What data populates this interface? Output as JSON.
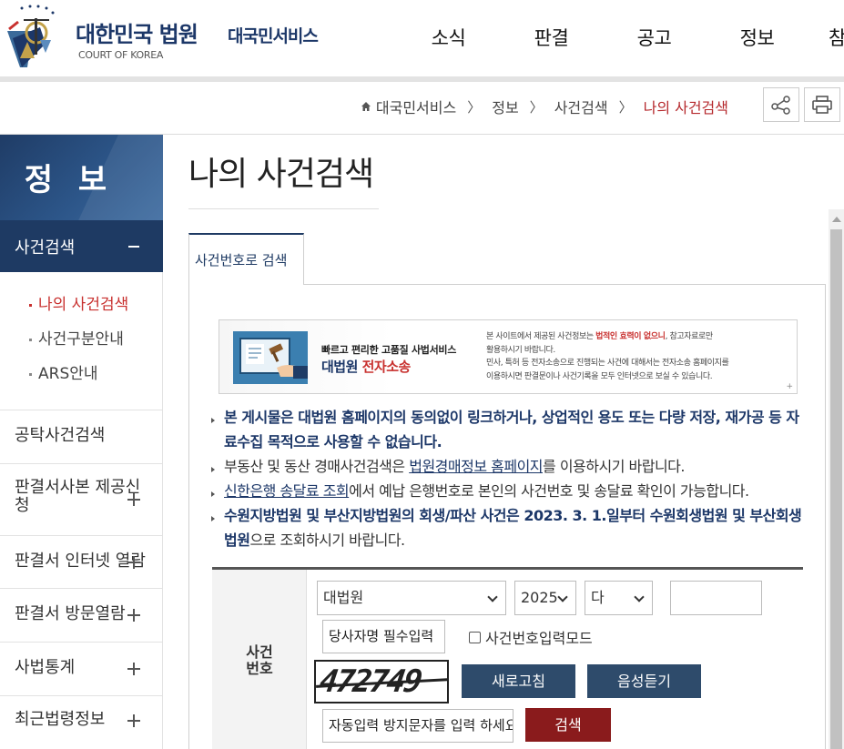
{
  "header": {
    "logo_title": "대한민국 법원",
    "logo_sub": "COURT OF KOREA",
    "service_name": "대국민서비스",
    "gnb": [
      "소식",
      "판결",
      "공고",
      "정보",
      "참"
    ]
  },
  "breadcrumb": {
    "items": [
      "대국민서비스",
      "정보",
      "사건검색"
    ],
    "current": "나의 사건검색"
  },
  "lnb": {
    "title": "정 보",
    "active": "사건검색",
    "sub_items": [
      "나의 사건검색",
      "사건구분안내",
      "ARS안내"
    ],
    "items": [
      "공탁사건검색",
      "판결서사본 제공신청",
      "판결서 인터넷 열람",
      "판결서 방문열람",
      "사법통계",
      "최근법령정보"
    ]
  },
  "page": {
    "title": "나의 사건검색",
    "tab": "사건번호로 검색"
  },
  "banner": {
    "line1": "빠르고 편리한 고품질 사법서비스",
    "line2_a": "대법원",
    "line2_b": " 전자소송",
    "desc1_a": "본 사이트에서 제공된 사건정보는 ",
    "desc1_em": "법적인 효력이 없으니",
    "desc1_b": ", 참고자료로만",
    "desc2": "활용하시기 바랍니다.",
    "desc3": "민사, 특허 등 전자소송으로 진행되는 사건에 대해서는 전자소송 홈페이지를",
    "desc4": "이용하시면 판결문이나 사건기록을 모두 인터넷으로 보실 수 있습니다.",
    "plus": "+"
  },
  "notices": {
    "n1": "본 게시물은 대법원 홈페이지의 동의없이 링크하거나, 상업적인 용도 또는 다량 저장, 재가공 등 자료수집 목적으로 사용할 수 없습니다.",
    "n2_a": "부동산 및 동산 경매사건검색은 ",
    "n2_link": "법원경매정보 홈페이지",
    "n2_b": "를 이용하시기 바랍니다.",
    "n3_link": "신한은행 송달료 조회",
    "n3_b": "에서 예납 은행번호로 본인의 사건번호 및 송달료 확인이 가능합니다.",
    "n4_a": "수원지방법원 및 부산지방법원의 회생/파산 사건은 2023. 3. 1.일부터 수원회생법원 및 부산회생법원",
    "n4_b": "으로 조회하시기 바랍니다."
  },
  "form": {
    "label": "사건번호",
    "court": "대법원",
    "year": "2025",
    "case_type": "다",
    "case_number": "",
    "party_name": "당사자명 필수입력",
    "mode_check": "사건번호입력모드",
    "captcha_text": "472749",
    "refresh_btn": "새로고침",
    "audio_btn": "음성듣기",
    "captcha_input": "자동입력 방지문자를 입력 하세요",
    "search_btn": "검색"
  },
  "colors": {
    "navy": "#1e3a63",
    "red": "#c8302e",
    "search": "#8a1b1c"
  }
}
